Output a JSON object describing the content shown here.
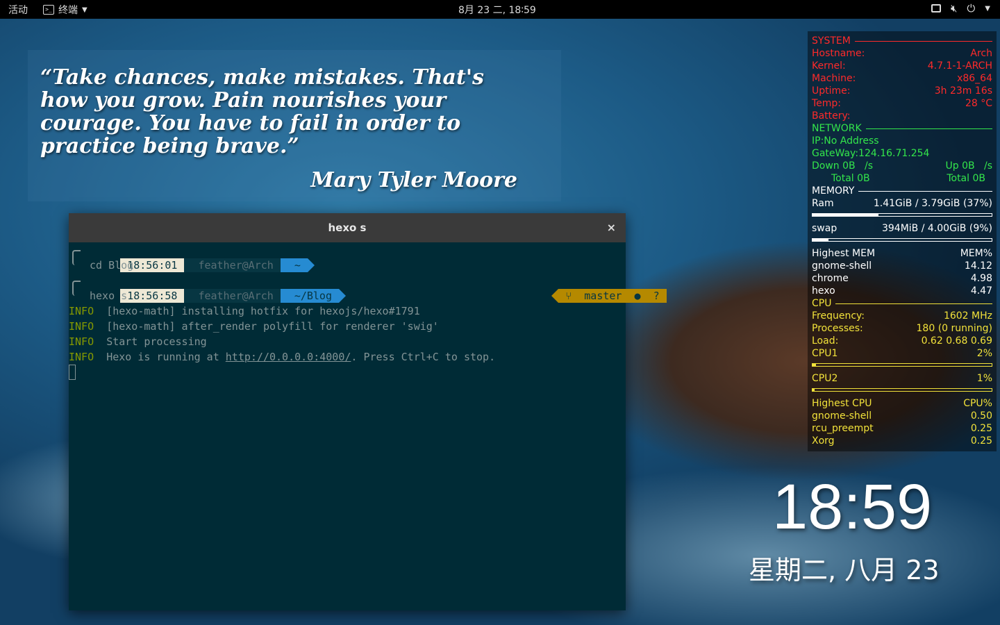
{
  "topbar": {
    "activities": "活动",
    "app_menu": "终端",
    "clock": "8月 23 二, 18∶59",
    "icons": [
      "window-icon",
      "volume-muted-icon",
      "power-icon",
      "chevron-down-icon"
    ]
  },
  "quote": {
    "text": "“Take chances, make mistakes. That's how you grow. Pain nourishes your courage. You have to fail in order to practice being brave.”",
    "author": "Mary Tyler Moore"
  },
  "terminal": {
    "title": "hexo s",
    "close": "×",
    "prompt1": {
      "time": "18:56:01",
      "user": "feather@Arch",
      "dir": "~"
    },
    "cmd1": "cd Blog",
    "prompt2": {
      "time": "18:56:58",
      "user": "feather@Arch",
      "dir": "~/Blog"
    },
    "git": {
      "icon": "⑂",
      "branch": "master",
      "status": "●  ?"
    },
    "cmd2": "hexo s",
    "log": [
      {
        "level": "INFO",
        "msg": "[hexo-math] installing hotfix for hexojs/hexo#1791"
      },
      {
        "level": "INFO",
        "msg": "[hexo-math] after_render polyfill for renderer 'swig'"
      },
      {
        "level": "INFO",
        "msg": "Start processing"
      },
      {
        "level": "INFO",
        "msg_pre": "Hexo is running at ",
        "url": "http://0.0.0.0:4000/",
        "msg_post": ". Press Ctrl+C to stop."
      }
    ]
  },
  "conky": {
    "system": {
      "header": "SYSTEM",
      "rows": [
        {
          "label": "Hostname:",
          "value": "Arch"
        },
        {
          "label": "Kernel:",
          "value": "4.7.1-1-ARCH"
        },
        {
          "label": "Machine:",
          "value": "x86_64"
        },
        {
          "label": "Uptime:",
          "value": "3h 23m 16s"
        },
        {
          "label": "Temp:",
          "value": "28 °C"
        },
        {
          "label": "Battery:",
          "value": ""
        }
      ]
    },
    "network": {
      "header": "NETWORK",
      "ip": "IP:No Address",
      "gateway": "GateWay:124.16.71.254",
      "down": "Down 0B   /s",
      "up": "Up 0B   /s",
      "total_down": "Total 0B",
      "total_up": "Total 0B"
    },
    "memory": {
      "header": "MEMORY",
      "ram_label": "Ram",
      "ram_value": "1.41GiB / 3.79GiB (37%)",
      "ram_fraction": 0.37,
      "swap_label": "swap",
      "swap_value": "394MiB / 4.00GiB (9%)",
      "swap_fraction": 0.09,
      "top_header": "Highest MEM",
      "top_unit": "MEM%",
      "top": [
        {
          "name": "gnome-shell",
          "value": "14.12"
        },
        {
          "name": "chrome",
          "value": "4.98"
        },
        {
          "name": "hexo",
          "value": "4.47"
        }
      ]
    },
    "cpu": {
      "header": "CPU",
      "frequency_label": "Frequency:",
      "frequency": "1602 MHz",
      "processes_label": "Processes:",
      "processes": "180 (0 running)",
      "load_label": "Load:",
      "load": "0.62 0.68 0.69",
      "cpu1_label": "CPU1",
      "cpu1": "2%",
      "cpu1_fraction": 0.02,
      "cpu2_label": "CPU2",
      "cpu2": "1%",
      "cpu2_fraction": 0.01,
      "top_header": "Highest CPU",
      "top_unit": "CPU%",
      "top": [
        {
          "name": "gnome-shell",
          "value": "0.50"
        },
        {
          "name": "rcu_preempt",
          "value": "0.25"
        },
        {
          "name": "Xorg",
          "value": "0.25"
        }
      ]
    }
  },
  "desktop_clock": {
    "time": "18:59",
    "date": "星期二, 八月 23"
  },
  "colors": {
    "conky_system": "#ff2a2a",
    "conky_network": "#33e64b",
    "conky_memory": "#ffffff",
    "conky_cpu": "#f2e23a",
    "terminal_bg": "#002b36"
  }
}
